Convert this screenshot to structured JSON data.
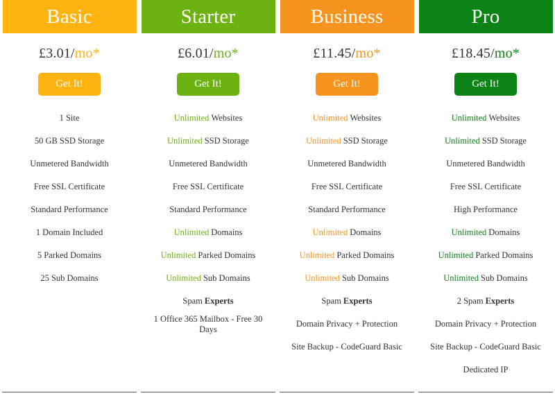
{
  "colors": {
    "basic": "#ffb30f",
    "starter": "#6cb211",
    "business": "#f7941e",
    "pro": "#0c8415",
    "text": "#333333",
    "divider": "#555555"
  },
  "plans": [
    {
      "name": "Basic",
      "accent": "#ffb30f",
      "price_amount": "£3.01/",
      "price_period": "mo*",
      "cta_label": "Get It!",
      "features": [
        {
          "highlight": "",
          "text": "1 Site",
          "bold": ""
        },
        {
          "highlight": "",
          "text": "50 GB SSD Storage",
          "bold": ""
        },
        {
          "highlight": "",
          "text": "Unmetered Bandwidth",
          "bold": ""
        },
        {
          "highlight": "",
          "text": "Free SSL Certificate",
          "bold": ""
        },
        {
          "highlight": "",
          "text": "Standard Performance",
          "bold": ""
        },
        {
          "highlight": "",
          "text": "1 Domain Included",
          "bold": ""
        },
        {
          "highlight": "",
          "text": "5 Parked Domains",
          "bold": ""
        },
        {
          "highlight": "",
          "text": "25 Sub Domains",
          "bold": ""
        }
      ]
    },
    {
      "name": "Starter",
      "accent": "#6cb211",
      "price_amount": "£6.01/",
      "price_period": "mo*",
      "cta_label": "Get It!",
      "features": [
        {
          "highlight": "Unlimited",
          "text": "Websites",
          "bold": ""
        },
        {
          "highlight": "Unlimited",
          "text": "SSD Storage",
          "bold": ""
        },
        {
          "highlight": "",
          "text": "Unmetered Bandwidth",
          "bold": ""
        },
        {
          "highlight": "",
          "text": "Free SSL Certificate",
          "bold": ""
        },
        {
          "highlight": "",
          "text": "Standard Performance",
          "bold": ""
        },
        {
          "highlight": "Unlimited",
          "text": "Domains",
          "bold": ""
        },
        {
          "highlight": "Unlimited",
          "text": "Parked Domains",
          "bold": ""
        },
        {
          "highlight": "Unlimited",
          "text": "Sub Domains",
          "bold": ""
        },
        {
          "highlight": "",
          "text": "Spam",
          "bold": "Experts"
        },
        {
          "highlight": "",
          "text": "1 Office 365 Mailbox - Free 30 Days",
          "bold": ""
        }
      ]
    },
    {
      "name": "Business",
      "accent": "#f7941e",
      "price_amount": "£11.45/",
      "price_period": "mo*",
      "cta_label": "Get It!",
      "features": [
        {
          "highlight": "Unlimited",
          "text": "Websites",
          "bold": ""
        },
        {
          "highlight": "Unlimited",
          "text": "SSD Storage",
          "bold": ""
        },
        {
          "highlight": "",
          "text": "Unmetered Bandwidth",
          "bold": ""
        },
        {
          "highlight": "",
          "text": "Free SSL Certificate",
          "bold": ""
        },
        {
          "highlight": "",
          "text": "Standard Performance",
          "bold": ""
        },
        {
          "highlight": "Unlimited",
          "text": "Domains",
          "bold": ""
        },
        {
          "highlight": "Unlimited",
          "text": "Parked Domains",
          "bold": ""
        },
        {
          "highlight": "Unlimited",
          "text": "Sub Domains",
          "bold": ""
        },
        {
          "highlight": "",
          "text": "Spam",
          "bold": "Experts"
        },
        {
          "highlight": "",
          "text": "Domain Privacy + Protection",
          "bold": ""
        },
        {
          "highlight": "",
          "text": "Site Backup - CodeGuard Basic",
          "bold": ""
        }
      ]
    },
    {
      "name": "Pro",
      "accent": "#0c8415",
      "price_amount": "£18.45/",
      "price_period": "mo*",
      "cta_label": "Get It!",
      "features": [
        {
          "highlight": "Unlimited",
          "text": "Websites",
          "bold": ""
        },
        {
          "highlight": "Unlimited",
          "text": "SSD Storage",
          "bold": ""
        },
        {
          "highlight": "",
          "text": "Unmetered Bandwidth",
          "bold": ""
        },
        {
          "highlight": "",
          "text": "Free SSL Certificate",
          "bold": ""
        },
        {
          "highlight": "",
          "text": "High Performance",
          "bold": ""
        },
        {
          "highlight": "Unlimited",
          "text": "Domains",
          "bold": ""
        },
        {
          "highlight": "Unlimited",
          "text": "Parked Domains",
          "bold": ""
        },
        {
          "highlight": "Unlimited",
          "text": "Sub Domains",
          "bold": ""
        },
        {
          "highlight": "",
          "text": "2 Spam",
          "bold": "Experts"
        },
        {
          "highlight": "",
          "text": "Domain Privacy + Protection",
          "bold": ""
        },
        {
          "highlight": "",
          "text": "Site Backup - CodeGuard Basic",
          "bold": ""
        },
        {
          "highlight": "",
          "text": "Dedicated IP",
          "bold": ""
        }
      ]
    }
  ]
}
